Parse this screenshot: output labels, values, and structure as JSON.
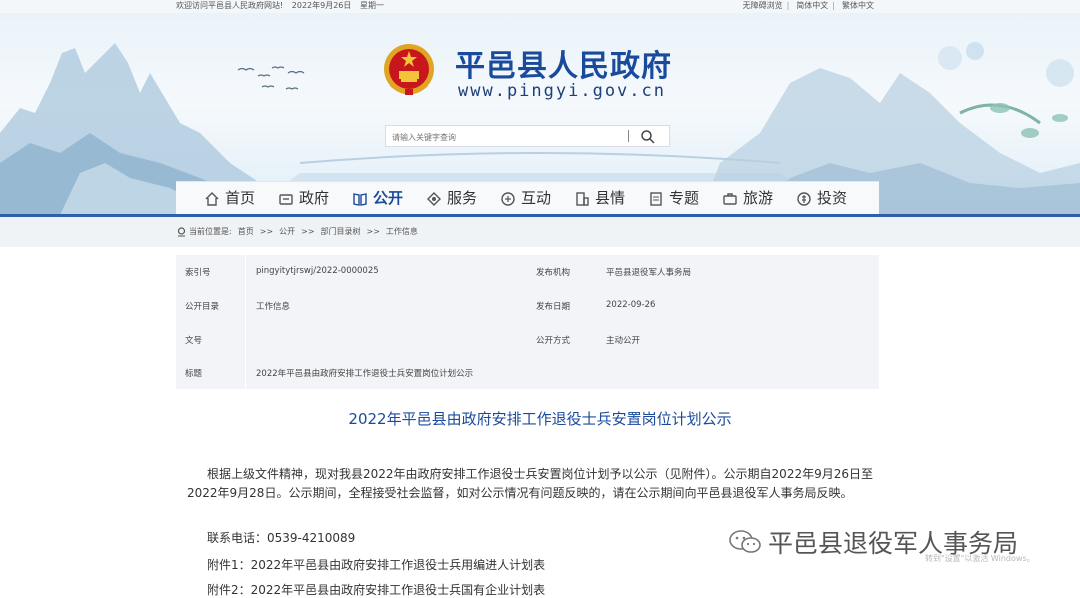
{
  "topbar": {
    "welcome": "欢迎访问平邑县人民政府网站!",
    "date": "2022年9月26日",
    "weekday": "星期一",
    "accessibility": "无障碍浏览",
    "simplified": "简体中文",
    "traditional": "繁体中文"
  },
  "header": {
    "site_title": "平邑县人民政府",
    "site_url": "www.pingyi.gov.cn",
    "search_placeholder": "请输入关键字查询"
  },
  "nav": {
    "items": [
      {
        "label": "首页",
        "icon": "home-icon"
      },
      {
        "label": "政府",
        "icon": "government-icon"
      },
      {
        "label": "公开",
        "icon": "book-icon",
        "active": true
      },
      {
        "label": "服务",
        "icon": "service-icon"
      },
      {
        "label": "互动",
        "icon": "interact-icon"
      },
      {
        "label": "县情",
        "icon": "building-icon"
      },
      {
        "label": "专题",
        "icon": "topic-icon"
      },
      {
        "label": "旅游",
        "icon": "travel-icon"
      },
      {
        "label": "投资",
        "icon": "investment-icon"
      }
    ]
  },
  "breadcrumb": {
    "prefix": "当前位置是:",
    "items": [
      "首页",
      "公开",
      "部门目录树",
      "工作信息"
    ],
    "sep": ">>"
  },
  "meta": {
    "index_label": "索引号",
    "index_value": "pingyitytjrswj/2022-0000025",
    "publisher_label": "发布机构",
    "publisher_value": "平邑县退役军人事务局",
    "catalog_label": "公开目录",
    "catalog_value": "工作信息",
    "date_label": "发布日期",
    "date_value": "2022-09-26",
    "docno_label": "文号",
    "docno_value": "",
    "method_label": "公开方式",
    "method_value": "主动公开",
    "title_label": "标题",
    "title_value": "2022年平邑县由政府安排工作退役士兵安置岗位计划公示"
  },
  "article": {
    "title": "2022年平邑县由政府安排工作退役士兵安置岗位计划公示",
    "paragraph": "根据上级文件精神，现对我县2022年由政府安排工作退役士兵安置岗位计划予以公示（见附件）。公示期自2022年9月26日至2022年9月28日。公示期间，全程接受社会监督，如对公示情况有问题反映的，请在公示期间向平邑县退役军人事务局反映。",
    "phone": "联系电话：0539-4210089",
    "attachment1": "附件1：2022年平邑县由政府安排工作退役士兵用编进人计划表",
    "attachment2": "附件2：2022年平邑县由政府安排工作退役士兵国有企业计划表"
  },
  "watermark": {
    "account": "平邑县退役军人事务局",
    "activate": "转到\"设置\"以激活 Windows。"
  },
  "colors": {
    "brand_blue": "#1a4a9c",
    "rule_blue": "#2e5fa8"
  }
}
